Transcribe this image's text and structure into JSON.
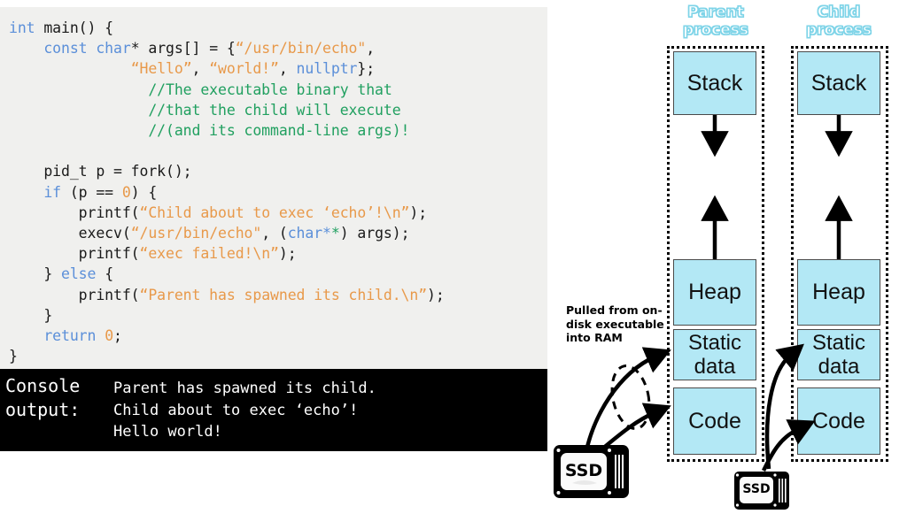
{
  "code_panel": {
    "language": "cpp",
    "lines": [
      [
        {
          "t": "int ",
          "c": "kw"
        },
        {
          "t": "main() {",
          "c": "pl"
        }
      ],
      [
        {
          "t": "    ",
          "c": "pl"
        },
        {
          "t": "const char",
          "c": "kw"
        },
        {
          "t": "* args[] = {",
          "c": "pl"
        },
        {
          "t": "“/usr/bin/echo\"",
          "c": "str"
        },
        {
          "t": ",",
          "c": "pl"
        }
      ],
      [
        {
          "t": "              ",
          "c": "pl"
        },
        {
          "t": "“Hello”",
          "c": "str"
        },
        {
          "t": ", ",
          "c": "pl"
        },
        {
          "t": "“world!”",
          "c": "str"
        },
        {
          "t": ", ",
          "c": "pl"
        },
        {
          "t": "nullptr",
          "c": "kw"
        },
        {
          "t": "};",
          "c": "pl"
        }
      ],
      [
        {
          "t": "                ",
          "c": "pl"
        },
        {
          "t": "//The executable binary that",
          "c": "cmt"
        }
      ],
      [
        {
          "t": "                ",
          "c": "pl"
        },
        {
          "t": "//that the child will execute",
          "c": "cmt"
        }
      ],
      [
        {
          "t": "                ",
          "c": "pl"
        },
        {
          "t": "//(and its command-line args)!",
          "c": "cmt"
        }
      ],
      [
        {
          "t": "",
          "c": "pl"
        }
      ],
      [
        {
          "t": "    pid_t p = fork();",
          "c": "pl"
        }
      ],
      [
        {
          "t": "    ",
          "c": "pl"
        },
        {
          "t": "if",
          "c": "kw"
        },
        {
          "t": " (p == ",
          "c": "pl"
        },
        {
          "t": "0",
          "c": "num"
        },
        {
          "t": ") {",
          "c": "pl"
        }
      ],
      [
        {
          "t": "        printf(",
          "c": "pl"
        },
        {
          "t": "“Child about to exec ‘echo’!\\n”",
          "c": "str"
        },
        {
          "t": ");",
          "c": "pl"
        }
      ],
      [
        {
          "t": "        execv(",
          "c": "pl"
        },
        {
          "t": "“/usr/bin/echo\"",
          "c": "str"
        },
        {
          "t": ", (",
          "c": "pl"
        },
        {
          "t": "char*",
          "c": "kw"
        },
        {
          "t": "*",
          "c": "cmt"
        },
        {
          "t": ") args);",
          "c": "pl"
        }
      ],
      [
        {
          "t": "        printf(",
          "c": "pl"
        },
        {
          "t": "“exec failed!\\n”",
          "c": "str"
        },
        {
          "t": ");",
          "c": "pl"
        }
      ],
      [
        {
          "t": "    } ",
          "c": "pl"
        },
        {
          "t": "else",
          "c": "kw"
        },
        {
          "t": " {",
          "c": "pl"
        }
      ],
      [
        {
          "t": "        printf(",
          "c": "pl"
        },
        {
          "t": "“Parent has spawned its child.\\n”",
          "c": "str"
        },
        {
          "t": ");",
          "c": "pl"
        }
      ],
      [
        {
          "t": "    }",
          "c": "pl"
        }
      ],
      [
        {
          "t": "    ",
          "c": "pl"
        },
        {
          "t": "return ",
          "c": "kw"
        },
        {
          "t": "0",
          "c": "num"
        },
        {
          "t": ";",
          "c": "pl"
        }
      ],
      [
        {
          "t": "}",
          "c": "pl"
        }
      ]
    ]
  },
  "console": {
    "label": "Console\noutput:",
    "lines": "Parent has spawned its child.\nChild about to exec ‘echo’!\nHello world!"
  },
  "diagram": {
    "caption": "Pulled from on-disk executable into RAM",
    "parent": {
      "title": "Parent\nprocess",
      "segments": [
        {
          "name": "stack",
          "label": "Stack"
        },
        {
          "name": "heap",
          "label": "Heap"
        },
        {
          "name": "static-data",
          "label": "Static\ndata"
        },
        {
          "name": "code",
          "label": "Code"
        }
      ]
    },
    "child": {
      "title": "Child\nprocess",
      "segments": [
        {
          "name": "stack",
          "label": "Stack"
        },
        {
          "name": "heap",
          "label": "Heap"
        },
        {
          "name": "static-data",
          "label": "Static\ndata"
        },
        {
          "name": "code",
          "label": "Code"
        }
      ]
    },
    "ssd_left": {
      "label": "SSD"
    },
    "ssd_right": {
      "label": "SSD"
    },
    "colors": {
      "segment_fill": "#B3E8F5",
      "segment_border": "#4a4a4a",
      "title_outline": "#7FD4E8",
      "code_bg": "#F0F0EE",
      "console_bg": "#000000"
    }
  }
}
